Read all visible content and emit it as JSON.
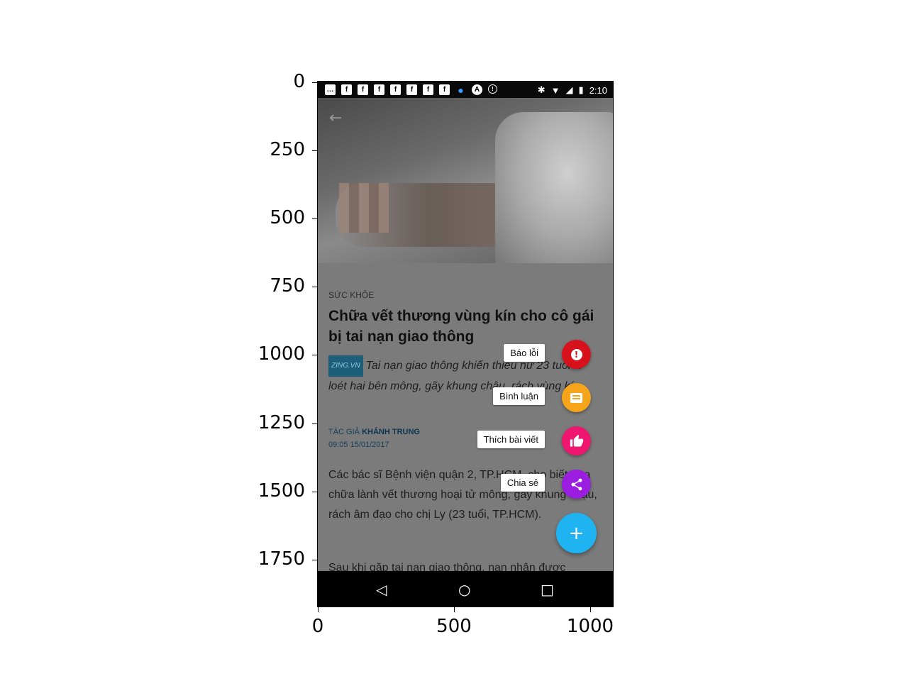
{
  "axes": {
    "y_ticks": [
      "0",
      "250",
      "500",
      "750",
      "1000",
      "1250",
      "1500",
      "1750"
    ],
    "x_ticks": [
      "0",
      "500",
      "1000"
    ]
  },
  "statusbar": {
    "time": "2:10",
    "left_icons": [
      "chat-icon",
      "facebook-icon",
      "facebook-icon",
      "facebook-icon",
      "facebook-icon",
      "facebook-icon",
      "facebook-icon",
      "facebook-icon",
      "water-drop-icon",
      "app-icon",
      "info-icon"
    ],
    "right_icons": [
      "bluetooth-icon",
      "wifi-icon",
      "signal-icon",
      "battery-icon"
    ]
  },
  "article": {
    "category": "SỨC KHỎE",
    "headline": "Chữa vết thương vùng kín cho cô gái bị tai nạn giao thông",
    "source": "ZING.VN",
    "sapo": "Tai nạn giao thông khiến thiếu nữ 23 tuổi lở loét hai bên mông, gãy khung chậu, rách vùng kín.",
    "author_prefix": "TÁC GIẢ",
    "author_name": "KHÁNH TRUNG",
    "date": "09:05 15/01/2017",
    "body": "Các bác sĩ Bệnh viện quận 2, TP.HCM, cho biết vừa chữa lành vết thương hoại tử mông, gãy khung chậu, rách âm đạo cho chị Ly (23 tuổi, TP.HCM).",
    "body2": "Sau khi gặp tai nạn giao thông, nạn nhân được"
  },
  "fab_menu": {
    "items": [
      {
        "label": "Báo lỗi",
        "icon": "report-icon",
        "color": "#d8121c",
        "glyph": "!"
      },
      {
        "label": "Bình luận",
        "icon": "comment-icon",
        "color": "#f6a51a",
        "glyph": "▤"
      },
      {
        "label": "Thích bài viết",
        "icon": "thumbs-up-icon",
        "color": "#ef1670",
        "glyph": "👍"
      },
      {
        "label": "Chia sẻ",
        "icon": "share-icon",
        "color": "#9b1ee0",
        "glyph": "⋖"
      }
    ],
    "main_glyph": "+"
  },
  "navbar": {
    "back": "◁",
    "home": "○",
    "recents": "□"
  }
}
